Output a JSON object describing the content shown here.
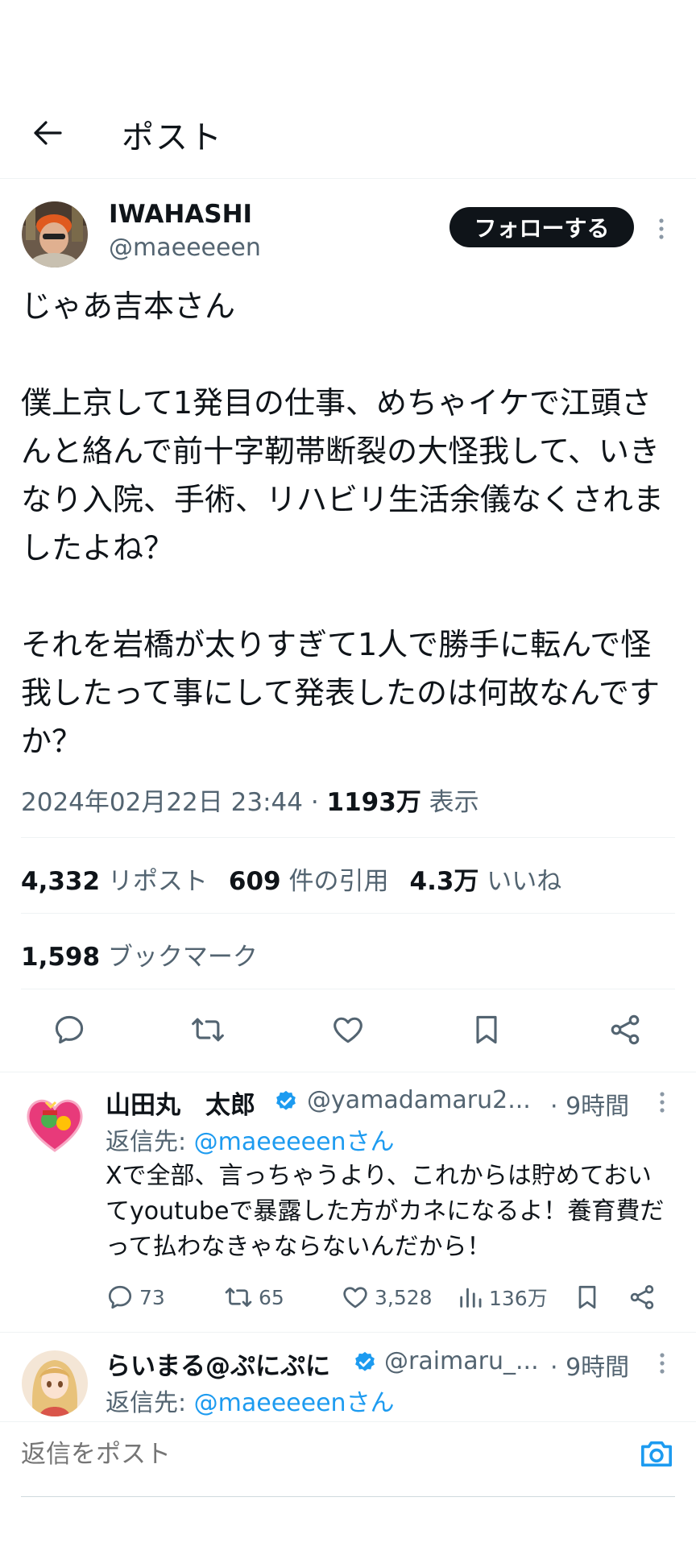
{
  "header": {
    "title": "ポスト"
  },
  "post": {
    "author_name": "IWAHASHI",
    "author_handle": "@maeeeeen",
    "follow_label": "フォローする",
    "body": "じゃあ吉本さん\n\n僕上京して1発目の仕事、めちゃイケで江頭さんと絡んで前十字靭帯断裂の大怪我して、いきなり入院、手術、リハビリ生活余儀なくされましたよね？\n\nそれを岩橋が太りすぎて1人で勝手に転んで怪我したって事にして発表したのは何故なんですか？",
    "timestamp": "2024年02月22日 23:44 · ",
    "views_count": "1193万",
    "views_label": " 表示",
    "reposts_count": "4,332",
    "reposts_label": " リポスト",
    "quotes_count": "609",
    "quotes_label": " 件の引用",
    "likes_count": "4.3万",
    "likes_label": " いいね",
    "bookmarks_count": "1,598",
    "bookmarks_label": " ブックマーク"
  },
  "replies": [
    {
      "name": "山田丸　太郎",
      "handle": "@yamadamaru2...",
      "time": "· 9時間",
      "reply_to_label": "返信先: ",
      "reply_to_mention": "@maeeeeenさん",
      "text": "Xで全部、言っちゃうより、これからは貯めておいてyoutubeで暴露した方がカネになるよ！養育費だって払わなきゃならないんだから！",
      "replies_count": "73",
      "reposts_count": "65",
      "likes_count": "3,528",
      "views_count": "136万"
    },
    {
      "name": "らいまる@ぷにぷに",
      "handle": "@raimaru_...",
      "time": "· 9時間",
      "reply_to_label": "返信先: ",
      "reply_to_mention": "@maeeeeenさん"
    }
  ],
  "composer": {
    "placeholder": "返信をポスト"
  },
  "colors": {
    "accent": "#1d9bf0",
    "text": "#0f1419",
    "muted": "#536471"
  }
}
